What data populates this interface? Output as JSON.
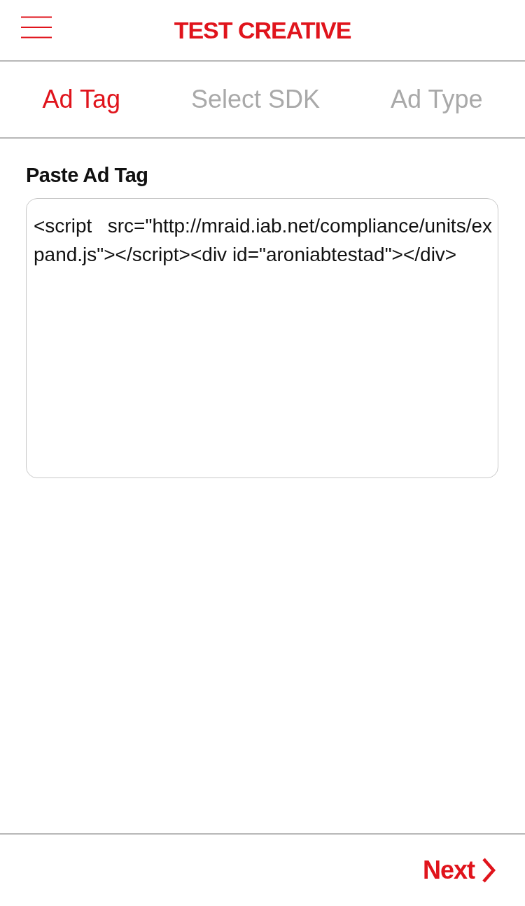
{
  "header": {
    "title": "TEST CREATIVE"
  },
  "tabs": [
    {
      "label": "Ad Tag",
      "selected": true
    },
    {
      "label": "Select SDK",
      "selected": false
    },
    {
      "label": "Ad Type",
      "selected": false
    }
  ],
  "ad_tag": {
    "label": "Paste Ad Tag",
    "value": "<script src=\"http://mraid.iab.net/compliance/units/expand.js\"></script><div id=\"aroniabtestad\"></div>"
  },
  "footer": {
    "next_button": "Next"
  }
}
